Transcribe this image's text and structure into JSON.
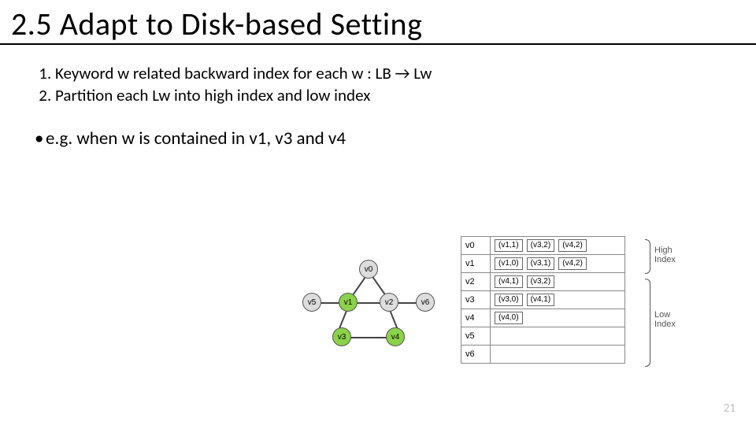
{
  "title": "2.5 Adapt to Disk-based Setting",
  "steps": [
    "Keyword w related backward index for each w : LB → Lw",
    "Partition each Lw into high index and low index"
  ],
  "example_line": "e.g. when w is contained in v1, v3 and v4",
  "page_number": "21",
  "graph": {
    "nodes": [
      {
        "id": "v0",
        "green": false
      },
      {
        "id": "v1",
        "green": true
      },
      {
        "id": "v2",
        "green": false
      },
      {
        "id": "v3",
        "green": true
      },
      {
        "id": "v4",
        "green": true
      },
      {
        "id": "v5",
        "green": false
      },
      {
        "id": "v6",
        "green": false
      }
    ]
  },
  "index_table": {
    "rows": [
      {
        "key": "v0",
        "entries": [
          "(v1,1)",
          "(v3,2)",
          "(v4,2)"
        ]
      },
      {
        "key": "v1",
        "entries": [
          "(v1,0)",
          "(v3,1)",
          "(v4,2)"
        ]
      },
      {
        "key": "v2",
        "entries": [
          "(v4,1)",
          "(v3,2)"
        ]
      },
      {
        "key": "v3",
        "entries": [
          "(v3,0)",
          "(v4,1)"
        ]
      },
      {
        "key": "v4",
        "entries": [
          "(v4,0)"
        ]
      },
      {
        "key": "v5",
        "entries": []
      },
      {
        "key": "v6",
        "entries": []
      }
    ],
    "high_label": "High\nIndex",
    "low_label": "Low\nIndex"
  }
}
